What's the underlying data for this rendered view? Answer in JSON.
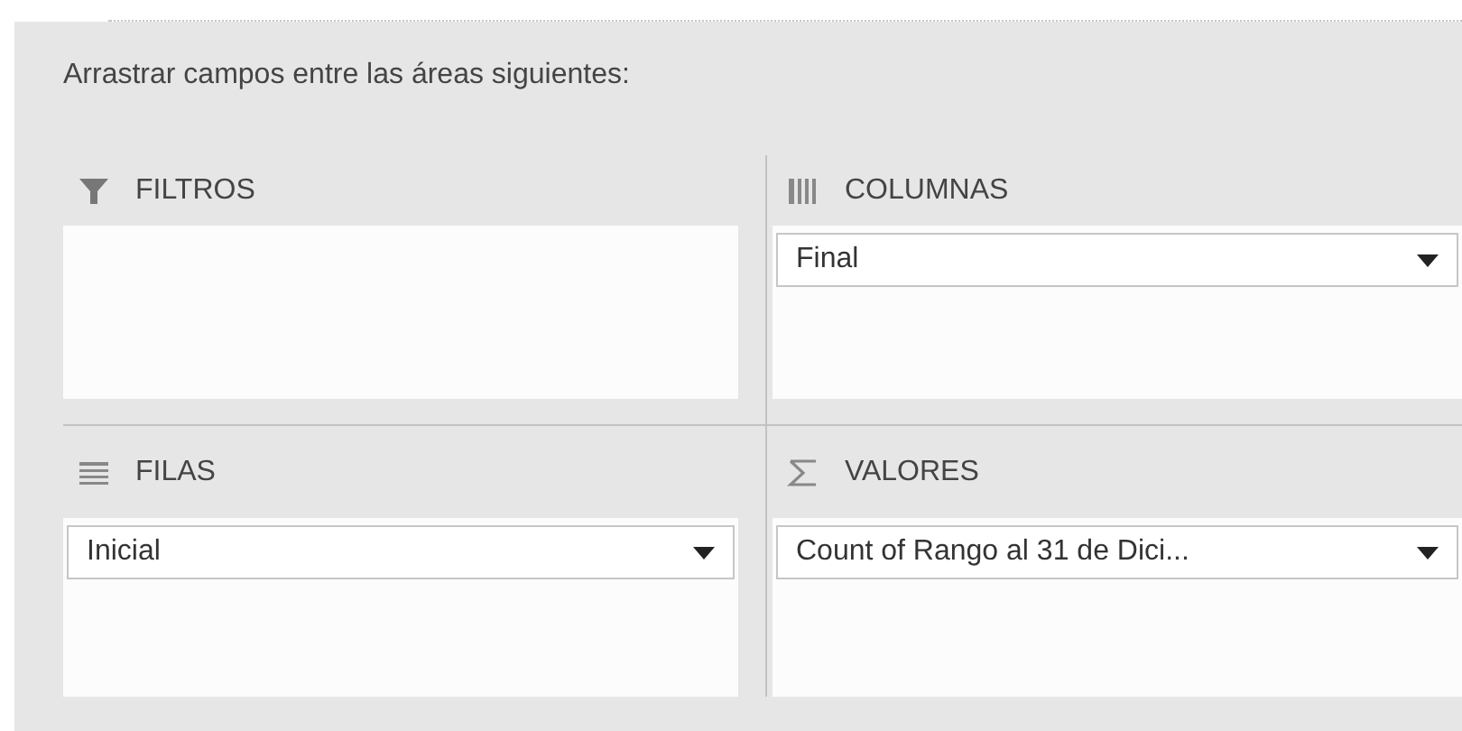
{
  "instruction": "Arrastrar campos entre las áreas siguientes:",
  "areas": [
    {
      "kind": "filters",
      "label": "FILTROS"
    },
    {
      "kind": "columns",
      "label": "COLUMNAS",
      "fields": [
        {
          "label": "Final"
        }
      ]
    },
    {
      "kind": "rows",
      "label": "FILAS",
      "fields": [
        {
          "label": "Inicial"
        }
      ]
    },
    {
      "kind": "values",
      "label": "VALORES",
      "fields": [
        {
          "label": "Count of Rango al 31 de Dici..."
        }
      ]
    }
  ]
}
